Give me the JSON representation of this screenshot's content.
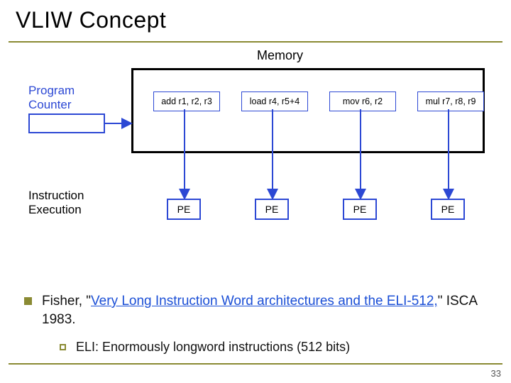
{
  "title": "VLIW Concept",
  "pageNumber": "33",
  "diagram": {
    "memoryLabel": "Memory",
    "programCounterLabel1": "Program",
    "programCounterLabel2": "Counter",
    "slots": [
      "add r1, r2, r3",
      "load r4, r5+4",
      "mov r6, r2",
      "mul r7, r8, r9"
    ],
    "instrExecLabel1": "Instruction",
    "instrExecLabel2": "Execution",
    "peLabel": "PE"
  },
  "bullet": {
    "prefix": "Fisher, \"",
    "link": "Very Long Instruction Word architectures and the ELI-512,",
    "suffix": "\" ISCA 1983."
  },
  "sub": {
    "text": "ELI: Enormously longword instructions (512 bits)"
  }
}
